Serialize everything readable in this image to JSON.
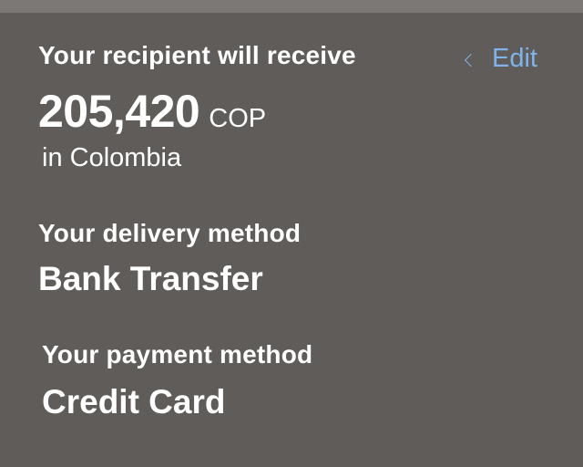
{
  "summary": {
    "recipient_heading": "Your recipient will receive",
    "edit_label": "Edit",
    "amount": "205,420",
    "currency": "COP",
    "country_text": "in Colombia",
    "delivery_heading": "Your delivery method",
    "delivery_value": "Bank Transfer",
    "payment_heading": "Your payment method",
    "payment_value": "Credit Card"
  },
  "icons": {
    "edit_chevron": "chevron-left-icon"
  },
  "colors": {
    "background": "#5f5c59",
    "top_strip": "#7b7875",
    "link": "#7fb3ec",
    "text": "#ffffff"
  }
}
